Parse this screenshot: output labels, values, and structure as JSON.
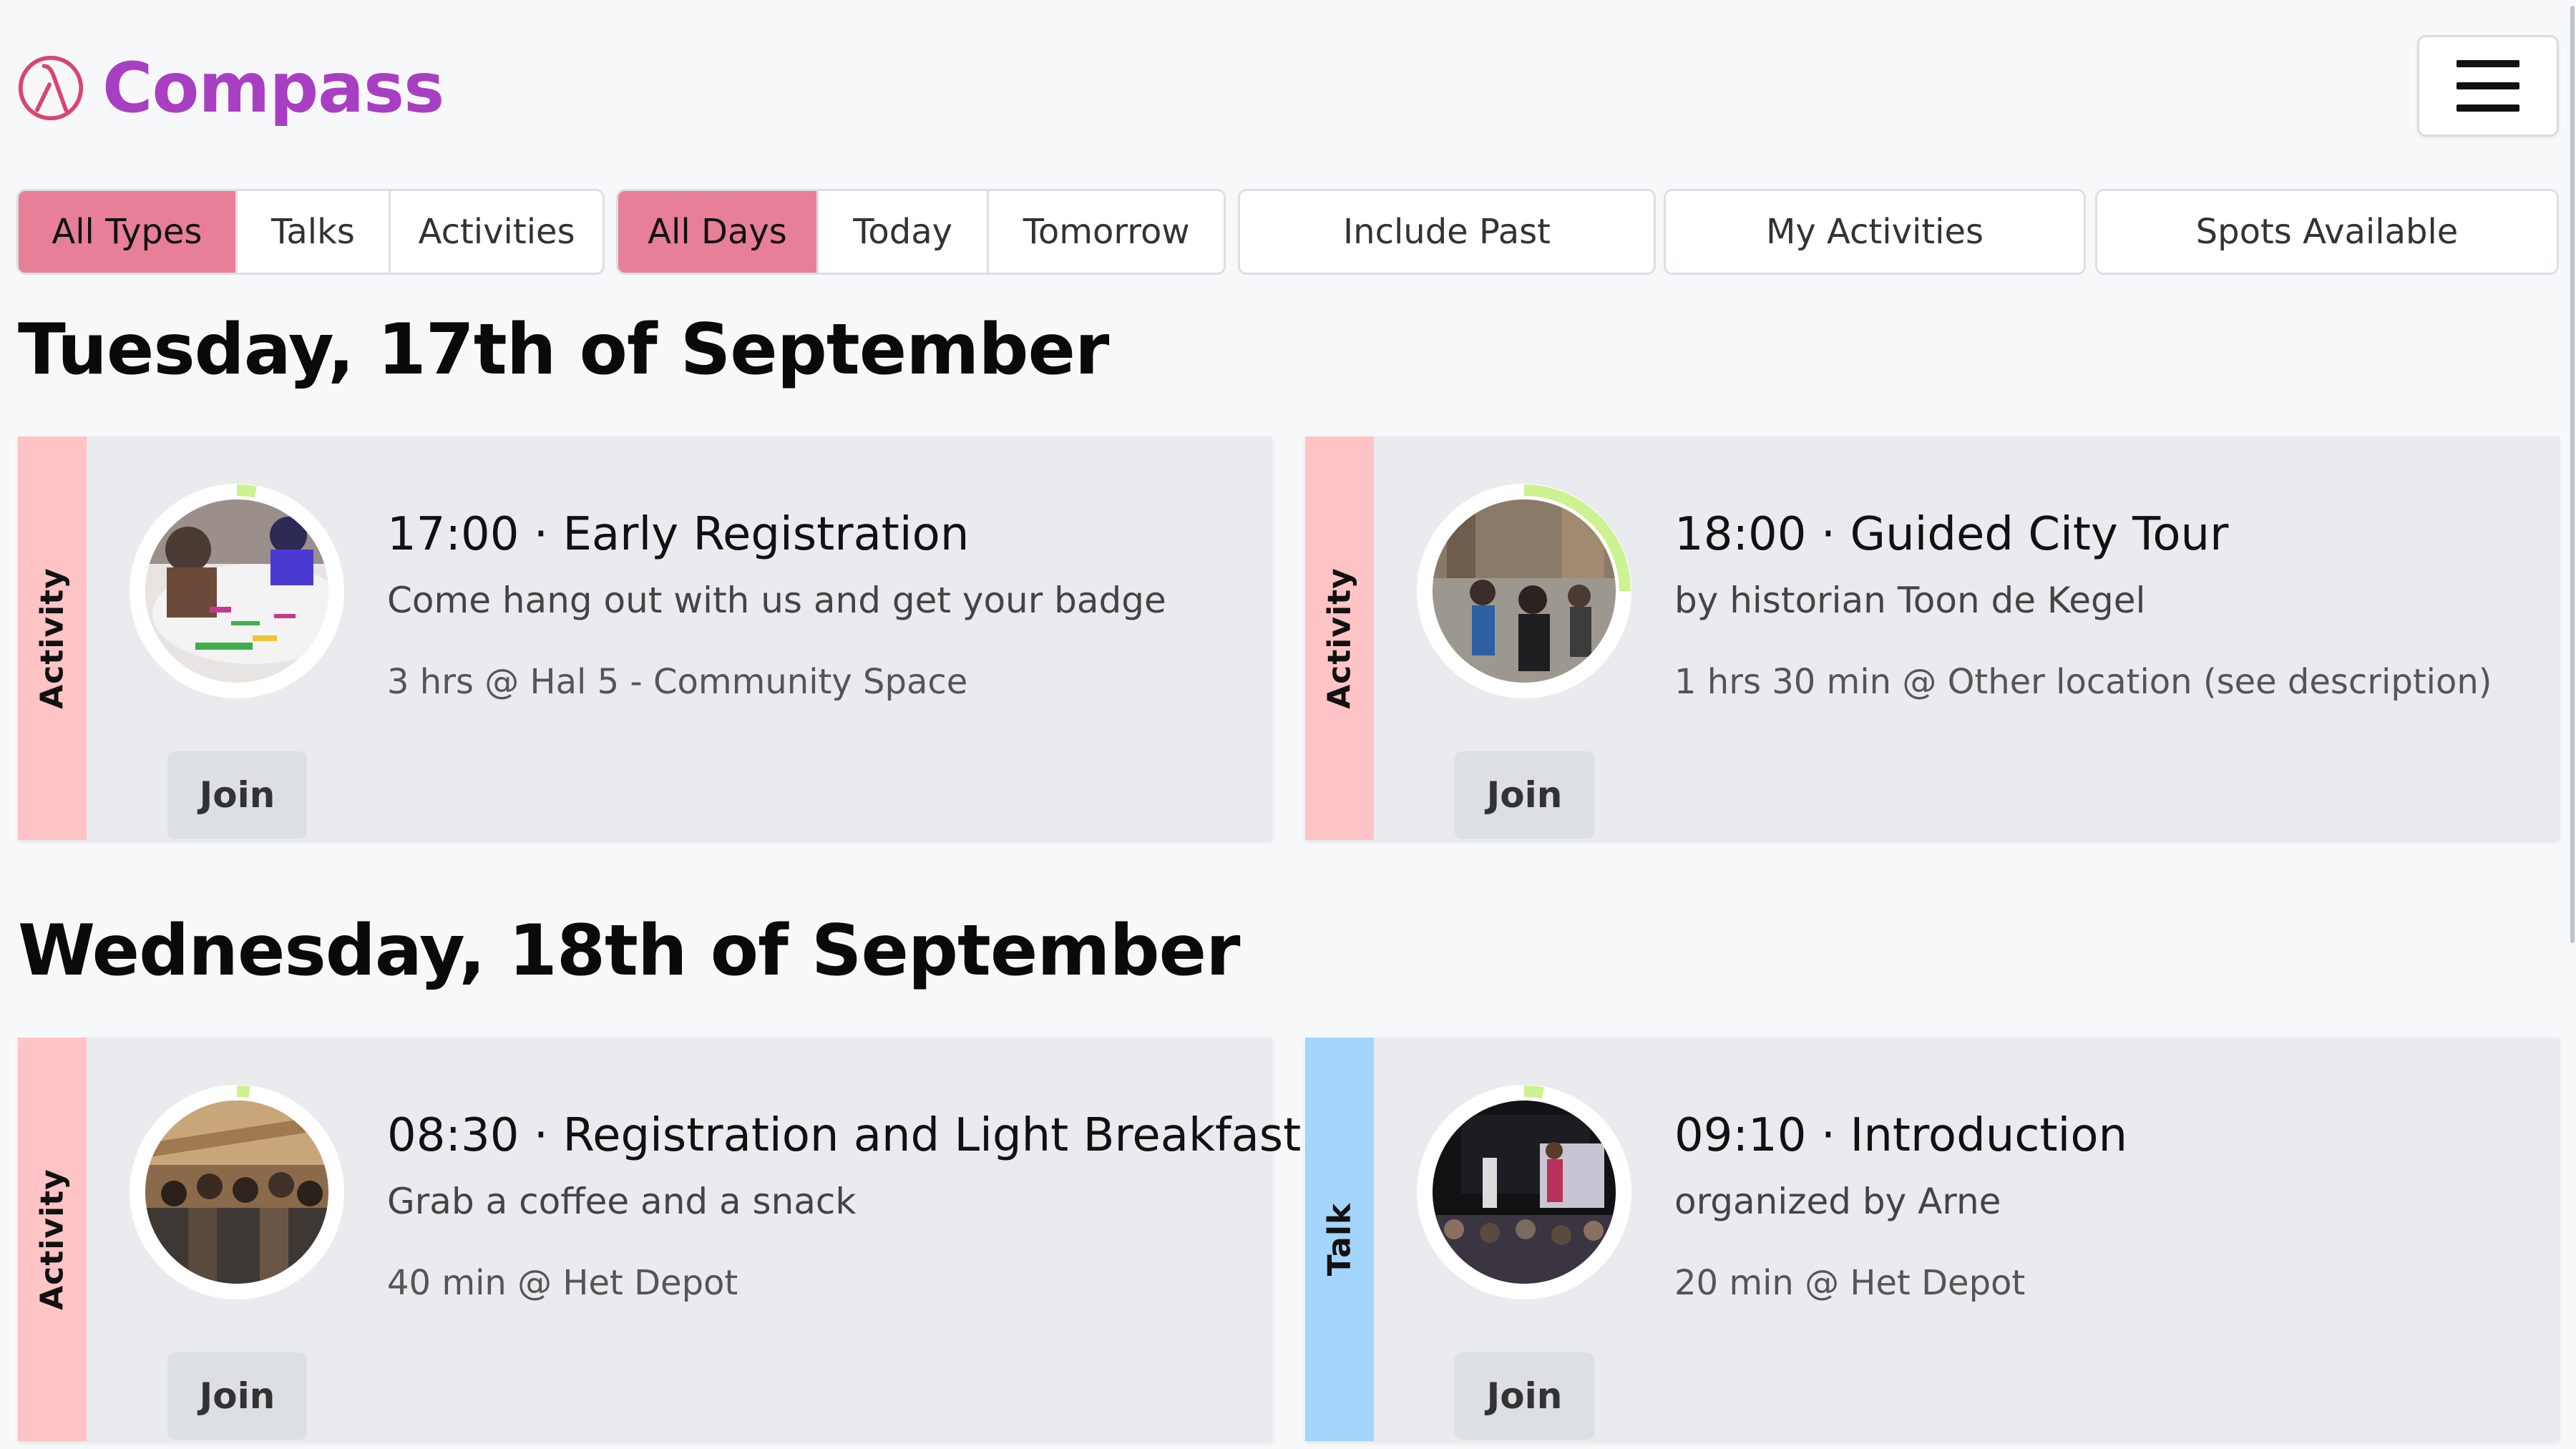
{
  "app": {
    "name": "Compass"
  },
  "filters": {
    "types": [
      "All Types",
      "Talks",
      "Activities"
    ],
    "days": [
      "All Days",
      "Today",
      "Tomorrow"
    ],
    "include_past": "Include Past",
    "my_activities": "My Activities",
    "spots_available": "Spots Available"
  },
  "days": [
    {
      "heading": "Tuesday, 17th of September",
      "events": [
        {
          "type": "Activity",
          "title": "17:00 · Early Registration",
          "subtitle": "Come hang out with us and get your badge",
          "meta": "3 hrs @ Hal 5 - Community Space",
          "join": "Join",
          "progress": 0.03
        },
        {
          "type": "Activity",
          "title": "18:00 · Guided City Tour",
          "subtitle": "by historian Toon de Kegel",
          "meta": "1 hrs 30 min @ Other location (see description)",
          "join": "Join",
          "progress": 0.25
        }
      ]
    },
    {
      "heading": "Wednesday, 18th of September",
      "events": [
        {
          "type": "Activity",
          "title": "08:30 · Registration and Light Breakfast",
          "subtitle": "Grab a coffee and a snack",
          "meta": "40 min @ Het Depot",
          "join": "Join",
          "progress": 0.02
        },
        {
          "type": "Talk",
          "title": "09:10 · Introduction",
          "subtitle": "organized by Arne",
          "meta": "20 min @ Het Depot",
          "join": "Join",
          "progress": 0.03
        }
      ]
    }
  ],
  "colors": {
    "brand": "#a83fc2",
    "active_filter": "#e77f98",
    "activity_stripe": "#ffc4c5",
    "talk_stripe": "#a4d5fc",
    "progress_arc": "#ccf291"
  }
}
